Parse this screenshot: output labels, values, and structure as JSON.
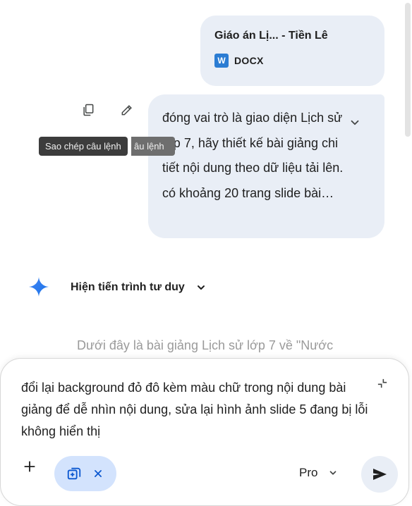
{
  "attachment": {
    "file_name": "Giáo án Lị... - Tiền Lê",
    "file_badge": "W",
    "file_type": "DOCX"
  },
  "prompt_actions": {
    "copy_icon": "copy-icon",
    "edit_icon": "pencil-icon",
    "tooltip": "Sao chép câu lệnh",
    "tooltip_ghost": "âu lệnh"
  },
  "user_prompt": {
    "text": "đóng vai trò là giao diện Lịch sử lớp 7, hãy thiết kế bài giảng chi tiết nội dung theo dữ liệu tải lên. có khoảng 20 trang slide bài…",
    "expand_icon": "chevron-down-icon"
  },
  "thinking": {
    "label": "Hiện tiến trình tư duy",
    "icon": "gemini-sparkle-icon"
  },
  "response": {
    "preview": "Dưới đây là bài giảng Lịch sử lớp 7 về \"Nước"
  },
  "composer": {
    "input_text": "đổi lại background đỏ đô kèm màu chữ trong nội dung bài giảng để dễ  nhìn nội dung, sửa lại hình ảnh slide 5 đang bị lỗi không hiển thị",
    "model": "Pro",
    "send_icon": "send-icon",
    "add_icon": "plus-icon",
    "chip_icon": "add-to-drive-icon",
    "chip_close_icon": "close-icon",
    "fullscreen_icon": "collapse-icon"
  },
  "colors": {
    "bubble": "#e9eef6",
    "accent_blue": "#1a73e8",
    "chip": "#d3e3fd",
    "word": "#2b7cd3"
  }
}
